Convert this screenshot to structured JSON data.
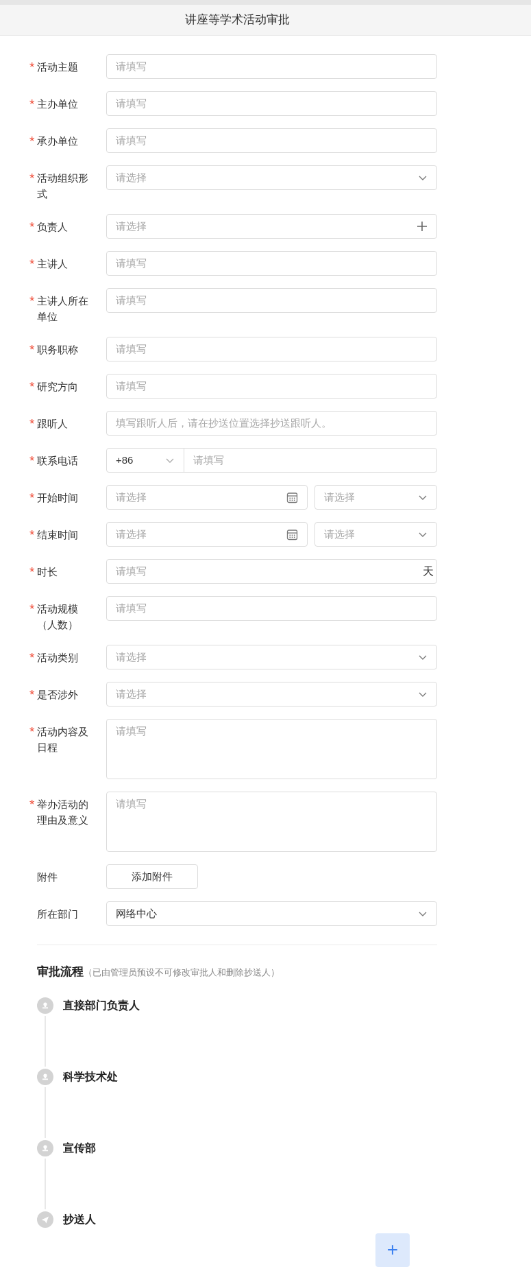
{
  "header": {
    "title": "讲座等学术活动审批"
  },
  "fields": [
    {
      "kind": "text",
      "required": true,
      "mark": "*",
      "label": "活动主题",
      "placeholder": "请填写"
    },
    {
      "kind": "text",
      "required": true,
      "mark": "*",
      "label": "主办单位",
      "placeholder": "请填写"
    },
    {
      "kind": "text",
      "required": true,
      "mark": "*",
      "label": "承办单位",
      "placeholder": "请填写"
    },
    {
      "kind": "select",
      "required": true,
      "mark": "*",
      "label": "活动组织形式",
      "placeholder": "请选择"
    },
    {
      "kind": "person",
      "required": true,
      "mark": "*",
      "label": "负责人",
      "placeholder": "请选择"
    },
    {
      "kind": "text",
      "required": true,
      "mark": "*",
      "label": "主讲人",
      "placeholder": "请填写"
    },
    {
      "kind": "text",
      "required": true,
      "mark": "*",
      "label": "主讲人所在单位",
      "placeholder": "请填写"
    },
    {
      "kind": "text",
      "required": true,
      "mark": "*",
      "label": "职务职称",
      "placeholder": "请填写"
    },
    {
      "kind": "text",
      "required": true,
      "mark": "*",
      "label": "研究方向",
      "placeholder": "请填写"
    },
    {
      "kind": "text",
      "required": true,
      "mark": "*",
      "label": "跟听人",
      "placeholder": "填写跟听人后，请在抄送位置选择抄送跟听人。"
    },
    {
      "kind": "phone",
      "required": true,
      "mark": "*",
      "label": "联系电话",
      "code": "+86",
      "placeholder": "请填写"
    },
    {
      "kind": "datetime",
      "required": true,
      "mark": "*",
      "label": "开始时间",
      "placeholder": "请选择",
      "time_placeholder": "请选择"
    },
    {
      "kind": "datetime",
      "required": true,
      "mark": "*",
      "label": "结束时间",
      "placeholder": "请选择",
      "time_placeholder": "请选择"
    },
    {
      "kind": "duration",
      "required": true,
      "mark": "*",
      "label": "时长",
      "placeholder": "请填写",
      "unit": "天"
    },
    {
      "kind": "text",
      "required": true,
      "mark": "*",
      "label": "活动规模（人数）",
      "placeholder": "请填写"
    },
    {
      "kind": "select",
      "required": true,
      "mark": "*",
      "label": "活动类别",
      "placeholder": "请选择"
    },
    {
      "kind": "select",
      "required": true,
      "mark": "*",
      "label": "是否涉外",
      "placeholder": "请选择"
    },
    {
      "kind": "textarea",
      "required": true,
      "mark": "*",
      "label": "活动内容及日程",
      "placeholder": "请填写"
    },
    {
      "kind": "textarea",
      "required": true,
      "mark": "*",
      "label": "举办活动的理由及意义",
      "placeholder": "请填写"
    },
    {
      "kind": "attachment",
      "required": false,
      "label": "附件",
      "button": "添加附件"
    },
    {
      "kind": "select",
      "required": false,
      "label": "所在部门",
      "value": "网络中心"
    }
  ],
  "approval": {
    "title": "审批流程",
    "note": "（已由管理员预设不可修改审批人和删除抄送人）",
    "steps": [
      {
        "kind": "approver",
        "name": "直接部门负责人"
      },
      {
        "kind": "approver",
        "name": "科学技术处"
      },
      {
        "kind": "approver",
        "name": "宣传部"
      },
      {
        "kind": "cc",
        "name": "抄送人"
      }
    ],
    "add_button": "+"
  }
}
